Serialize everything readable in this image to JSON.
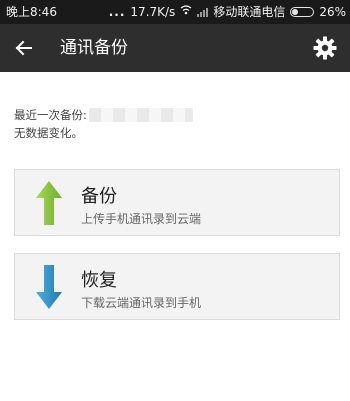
{
  "status_bar": {
    "time": "晚上8:46",
    "dots": "...",
    "net_speed": "17.7K/s",
    "carrier": "移动联通电信",
    "battery": "26%",
    "icons": [
      "wifi-icon",
      "signal-icon",
      "battery-icon"
    ]
  },
  "app_bar": {
    "title": "通讯备份",
    "back_icon": "arrow-left-icon",
    "settings_icon": "gear-icon",
    "background": "#2e2e2e"
  },
  "info": {
    "last_backup_label": "最近一次备份:",
    "status": "无数据变化。"
  },
  "actions": [
    {
      "title": "备份",
      "subtitle": "上传手机通讯录到云端",
      "icon": "arrow-up-icon",
      "color": "#8cc63f"
    },
    {
      "title": "恢复",
      "subtitle": "下载云端通讯录到手机",
      "icon": "arrow-down-icon",
      "color": "#2b8cc4"
    }
  ]
}
